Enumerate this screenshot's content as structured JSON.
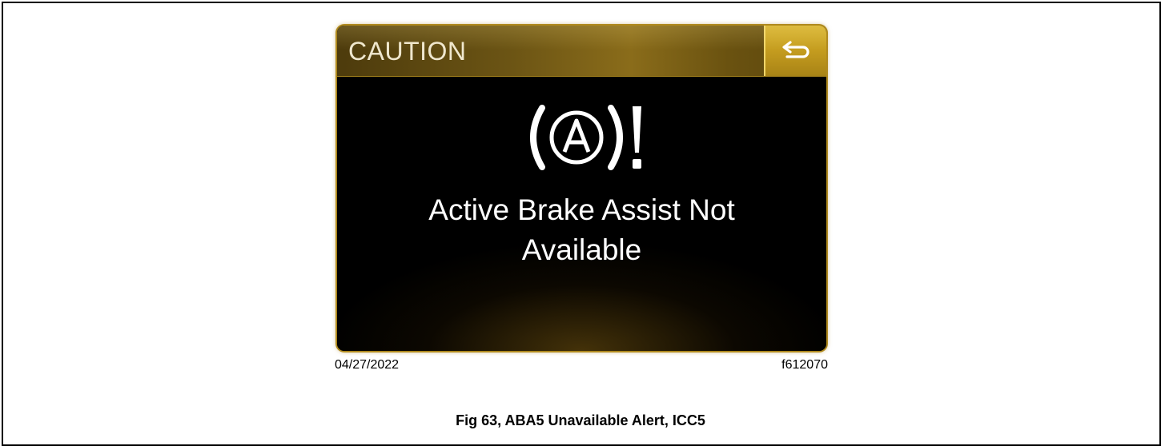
{
  "display": {
    "header_title": "CAUTION",
    "message_line1": "Active Brake Assist Not",
    "message_line2": "Available",
    "warning_icon": "active-brake-assist-warning-icon",
    "back_icon": "back-arrow-icon",
    "accent_color": "#c49c1f"
  },
  "figure": {
    "date": "04/27/2022",
    "id": "f612070",
    "caption": "Fig 63, ABA5 Unavailable Alert, ICC5"
  }
}
